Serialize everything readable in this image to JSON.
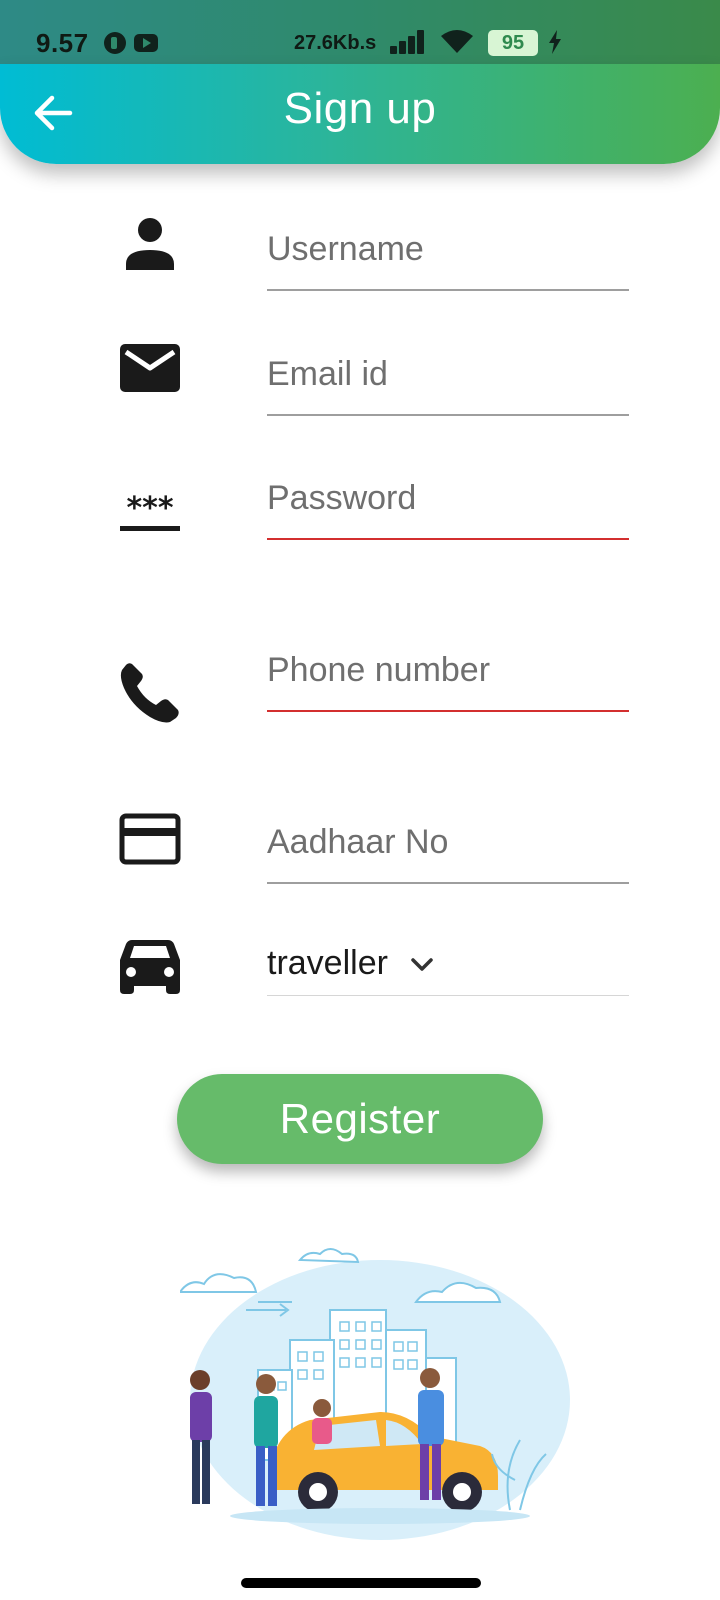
{
  "status_bar": {
    "time": "9.57",
    "network_speed": "27.6Kb.s",
    "battery": "95",
    "icons": [
      "app-notification-icon",
      "youtube-icon",
      "signal-icon",
      "wifi-icon",
      "battery-icon",
      "charging-icon"
    ]
  },
  "app_bar": {
    "title": "Sign up",
    "back_icon": "arrow-left-icon",
    "gradient": [
      "#00bcd4",
      "#4caf50"
    ]
  },
  "form": {
    "username": {
      "placeholder": "Username",
      "value": "",
      "icon": "person-icon"
    },
    "email": {
      "placeholder": "Email id",
      "value": "",
      "icon": "mail-icon"
    },
    "password": {
      "placeholder": "Password",
      "value": "",
      "icon": "password-icon"
    },
    "phone": {
      "placeholder": "Phone number",
      "value": "",
      "icon": "phone-icon"
    },
    "aadhaar": {
      "placeholder": "Aadhaar No",
      "value": "",
      "icon": "credit-card-icon"
    },
    "user_type": {
      "selected": "traveller",
      "icon": "car-icon"
    }
  },
  "colors": {
    "error_underline": "#d32f2f",
    "normal_underline": "#9e9e9e",
    "button": "#66bb6a"
  },
  "register_button": {
    "label": "Register"
  }
}
